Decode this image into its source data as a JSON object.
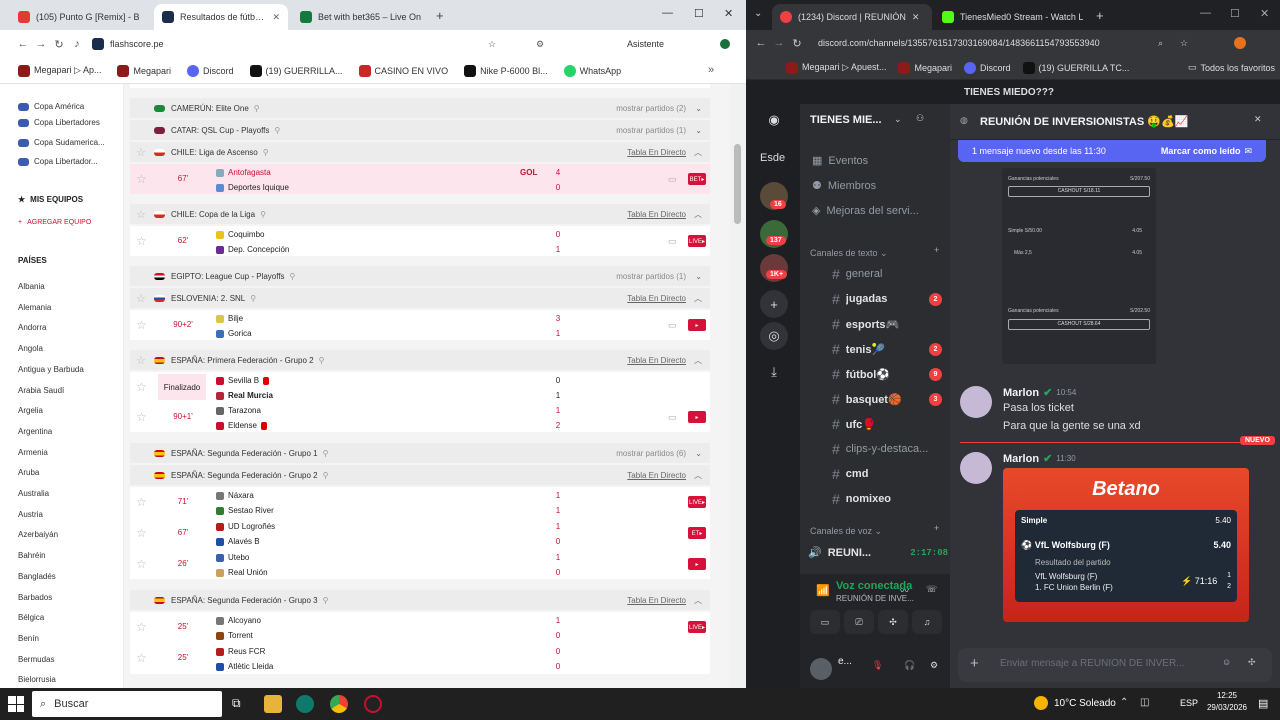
{
  "left_browser": {
    "tabs": [
      "(105) Punto G [Remix] - B",
      "Resultados de fútbol en v",
      "Bet with bet365 – Live On"
    ],
    "url": "flashscore.pe",
    "assistant": "Asistente",
    "bookmarks": [
      "Megapari ▷ Ap...",
      "Megapari",
      "Discord",
      "(19) GUERRILLA...",
      "CASINO EN VIVO",
      "Nike P-6000 Bl...",
      "WhatsApp"
    ],
    "sidebar": {
      "leagues": [
        "Copa América",
        "Copa Libertadores",
        "Copa Sudamerica...",
        "Copa Libertador..."
      ],
      "my_teams": "MIS EQUIPOS",
      "add_team": "AGREGAR EQUIPO",
      "countries_title": "PAÍSES",
      "countries": [
        "Albania",
        "Alemania",
        "Andorra",
        "Angola",
        "Antigua y Barbuda",
        "Arabia Saudí",
        "Argelia",
        "Argentina",
        "Armenia",
        "Aruba",
        "Australia",
        "Austria",
        "Azerbaiyán",
        "Bahréin",
        "Bangladés",
        "Barbados",
        "Bélgica",
        "Benín",
        "Bermudas",
        "Bielorrusia"
      ]
    },
    "leagues": [
      {
        "name": "CAMERÚN: Elite One",
        "right": "mostrar partidos (2)"
      },
      {
        "name": "CATAR: QSL Cup - Playoffs",
        "right": "mostrar partidos (1)"
      },
      {
        "name": "CHILE: Liga de Ascenso",
        "right": "Tabla En Directo"
      },
      {
        "name": "CHILE: Copa de la Liga",
        "right": "Tabla En Directo"
      },
      {
        "name": "EGIPTO: League Cup - Playoffs",
        "right": "mostrar partidos (1)"
      },
      {
        "name": "ESLOVENIA: 2. SNL",
        "right": "Tabla En Directo"
      },
      {
        "name": "ESPAÑA: Primera Federación - Grupo 2",
        "right": "Tabla En Directo"
      },
      {
        "name": "ESPAÑA: Segunda Federación - Grupo 1",
        "right": "mostrar partidos (6)"
      },
      {
        "name": "ESPAÑA: Segunda Federación - Grupo 2",
        "right": "Tabla En Directo"
      },
      {
        "name": "ESPAÑA: Segunda Federación - Grupo 3",
        "right": "Tabla En Directo"
      }
    ],
    "matches": [
      {
        "min": "67'",
        "home": "Antofagasta",
        "away": "Deportes Iquique",
        "hs": "4",
        "as": "0",
        "goal": "GOL",
        "live": "BET▸"
      },
      {
        "min": "62'",
        "home": "Coquimbo",
        "away": "Dep. Concepción",
        "hs": "0",
        "as": "1",
        "live": "LIVE▸"
      },
      {
        "min": "90+2'",
        "home": "Bilje",
        "away": "Gorica",
        "hs": "3",
        "as": "1",
        "live": "▸"
      },
      {
        "min": "Finalizado",
        "home": "Sevilla B",
        "away": "Real Murcia",
        "hs": "0",
        "as": "1"
      },
      {
        "min": "90+1'",
        "home": "Tarazona",
        "away": "Eldense",
        "hs": "1",
        "as": "2",
        "live": "▸"
      },
      {
        "min": "71'",
        "home": "Náxara",
        "away": "Sestao River",
        "hs": "1",
        "as": "1",
        "live": "LIVE▸"
      },
      {
        "min": "67'",
        "home": "UD Logroñés",
        "away": "Alavés B",
        "hs": "1",
        "as": "0",
        "live": "ET▸"
      },
      {
        "min": "26'",
        "home": "Utebo",
        "away": "Real Unión",
        "hs": "1",
        "as": "0",
        "live": "▸"
      },
      {
        "min": "25'",
        "home": "Alcoyano",
        "away": "Torrent",
        "hs": "1",
        "as": "0",
        "live": "LIVE▸"
      },
      {
        "min": "25'",
        "home": "Reus FCR",
        "away": "Atlètic Lleida",
        "hs": "0",
        "as": "0"
      }
    ]
  },
  "right_browser": {
    "tabs": [
      "(1234) Discord | REUNIÓN",
      "TienesMied0 Stream - Watch L"
    ],
    "url": "discord.com/channels/1355761517303169084/1483661154793553940",
    "bookmarks": [
      "Megapari ▷ Apuest...",
      "Megapari",
      "Discord",
      "(19) GUERRILLA TC...",
      "Todos los favoritos"
    ],
    "title": "TIENES MIEDO???",
    "server_name": "TIENES MIE...",
    "server_badges": [
      "16",
      "137",
      "1K+"
    ],
    "menu": [
      "Eventos",
      "Miembros",
      "Mejoras del servi..."
    ],
    "text_channels_label": "Canales de texto",
    "channels": [
      {
        "name": "general",
        "badge": ""
      },
      {
        "name": "jugadas",
        "badge": "2"
      },
      {
        "name": "esports🎮",
        "badge": ""
      },
      {
        "name": "tenis🎾",
        "badge": "2"
      },
      {
        "name": "fútbol⚽",
        "badge": "9"
      },
      {
        "name": "basquet🏀",
        "badge": "3"
      },
      {
        "name": "ufc🥊",
        "badge": ""
      },
      {
        "name": "clips-y-destaca...",
        "badge": ""
      },
      {
        "name": "cmd",
        "badge": ""
      },
      {
        "name": "nomixeo",
        "badge": ""
      }
    ],
    "voice_label": "Canales de voz",
    "voice_channel": "REUNI...",
    "voice_time": "2:17:08",
    "voice_connected": "Voz conectada",
    "voice_sub": "REUNIÓN DE INVE...",
    "user": "e...",
    "chat_title": "REUNIÓN DE INVERSIONISTAS 🤑💰📈",
    "new_msgs": "1 mensaje nuevo desde las 11:30",
    "mark_read": "Marcar como leído",
    "msgs": [
      {
        "user": "Marlon",
        "time": "10:54",
        "lines": [
          "Pasa los ticket",
          "Para que la gente se una xd"
        ]
      },
      {
        "user": "Marlon",
        "time": "11:30"
      }
    ],
    "new_label": "NUEVO",
    "bet": {
      "brand": "Betano",
      "type": "Simple",
      "odds": "5.40",
      "team": "VfL Wolfsburg (F)",
      "odds2": "5.40",
      "market": "Resultado del partido",
      "home": "VfL Wolfsburg (F)",
      "away": "1. FC Union Berlin (F)",
      "clock": "71:16",
      "s1": "1",
      "s2": "2"
    },
    "ticket": {
      "gain1": "S/207.50",
      "cashout": "CASHOUT S/18.11",
      "simple": "Simple S/50.00",
      "odds": "4.05",
      "mas": "Más 2,5",
      "odds_b": "4.05",
      "gain2": "S/202.50",
      "cashout2": "CASHOUT S/28.64"
    },
    "input_placeholder": "Enviar mensaje a REUNIÓN DE INVER..."
  },
  "taskbar": {
    "search": "Buscar",
    "weather": "10°C Soleado",
    "lang": "ESP",
    "time": "12:25",
    "date": "29/03/2026"
  }
}
